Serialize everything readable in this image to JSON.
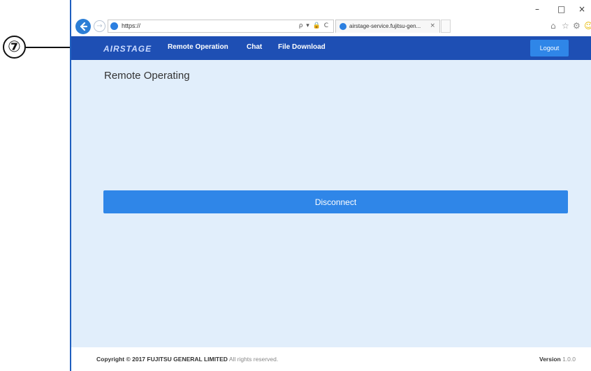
{
  "callout": {
    "number": "⑦"
  },
  "browser": {
    "url": "https://",
    "address_tools": "ρ ▾ 🔒 C",
    "tab_title": "airstage-service.fujitsu-gen...",
    "tab_close": "×",
    "window_controls": {
      "minimize": "–",
      "maximize": "□",
      "close": "×"
    },
    "toolbar_icons": [
      "⌂",
      "☆",
      "⚙",
      "☺"
    ]
  },
  "navbar": {
    "logo": "AIRSTAGE",
    "links": [
      "Remote Operation",
      "Chat",
      "File Download"
    ],
    "logout": "Logout"
  },
  "main": {
    "title": "Remote Operating",
    "disconnect_label": "Disconnect"
  },
  "footer": {
    "copyright_bold": "Copyright © 2017 FUJITSU GENERAL LIMITED",
    "copyright_light": " All rights reserved.",
    "version_label": "Version",
    "version_value": " 1.0.0"
  },
  "colors": {
    "navbar": "#1e4fb4",
    "accent_button": "#2f86e8",
    "content_bg": "#e1eefb"
  }
}
